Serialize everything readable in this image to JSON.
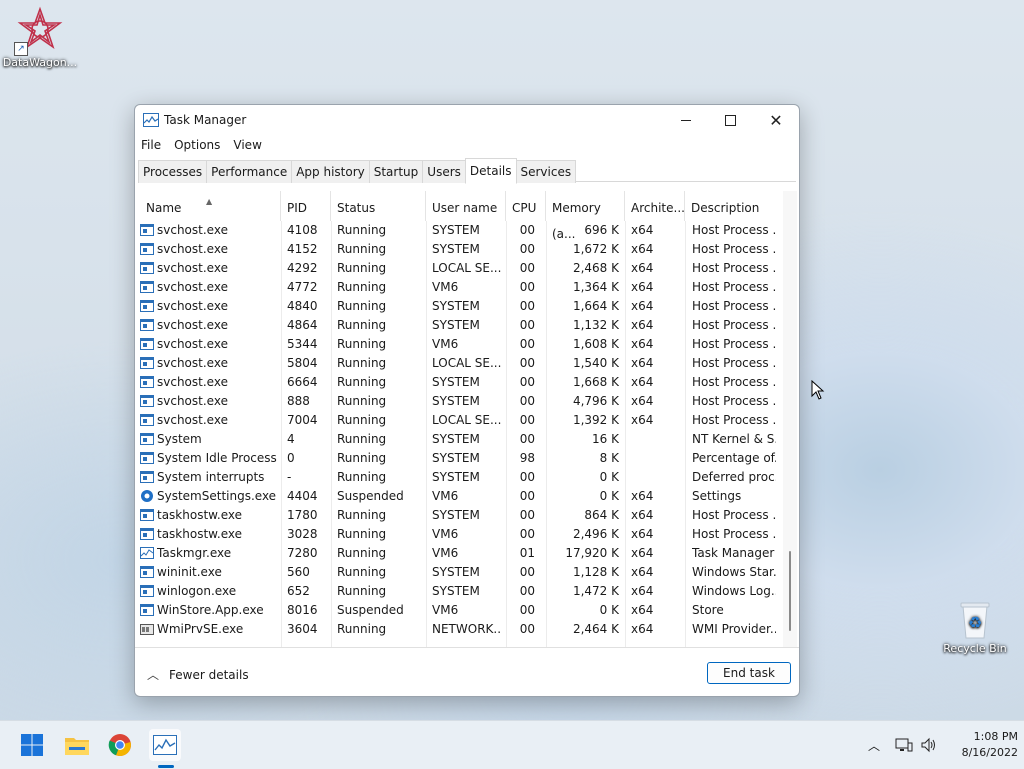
{
  "desktop": {
    "icons": [
      {
        "label": "DataWagon..."
      },
      {
        "label": "Recycle Bin"
      }
    ]
  },
  "window": {
    "title": "Task Manager",
    "menu": [
      "File",
      "Options",
      "View"
    ],
    "tabs": [
      "Processes",
      "Performance",
      "App history",
      "Startup",
      "Users",
      "Details",
      "Services"
    ],
    "active_tab": "Details",
    "columns": [
      "Name",
      "PID",
      "Status",
      "User name",
      "CPU",
      "Memory (a...",
      "Archite...",
      "Description"
    ],
    "rows": [
      {
        "name": "svchost.exe",
        "pid": "4108",
        "status": "Running",
        "user": "SYSTEM",
        "cpu": "00",
        "mem": "696 K",
        "arch": "x64",
        "desc": "Host Process ..."
      },
      {
        "name": "svchost.exe",
        "pid": "4152",
        "status": "Running",
        "user": "SYSTEM",
        "cpu": "00",
        "mem": "1,672 K",
        "arch": "x64",
        "desc": "Host Process ..."
      },
      {
        "name": "svchost.exe",
        "pid": "4292",
        "status": "Running",
        "user": "LOCAL SE...",
        "cpu": "00",
        "mem": "2,468 K",
        "arch": "x64",
        "desc": "Host Process ..."
      },
      {
        "name": "svchost.exe",
        "pid": "4772",
        "status": "Running",
        "user": "VM6",
        "cpu": "00",
        "mem": "1,364 K",
        "arch": "x64",
        "desc": "Host Process ..."
      },
      {
        "name": "svchost.exe",
        "pid": "4840",
        "status": "Running",
        "user": "SYSTEM",
        "cpu": "00",
        "mem": "1,664 K",
        "arch": "x64",
        "desc": "Host Process ..."
      },
      {
        "name": "svchost.exe",
        "pid": "4864",
        "status": "Running",
        "user": "SYSTEM",
        "cpu": "00",
        "mem": "1,132 K",
        "arch": "x64",
        "desc": "Host Process ..."
      },
      {
        "name": "svchost.exe",
        "pid": "5344",
        "status": "Running",
        "user": "VM6",
        "cpu": "00",
        "mem": "1,608 K",
        "arch": "x64",
        "desc": "Host Process ..."
      },
      {
        "name": "svchost.exe",
        "pid": "5804",
        "status": "Running",
        "user": "LOCAL SE...",
        "cpu": "00",
        "mem": "1,540 K",
        "arch": "x64",
        "desc": "Host Process ..."
      },
      {
        "name": "svchost.exe",
        "pid": "6664",
        "status": "Running",
        "user": "SYSTEM",
        "cpu": "00",
        "mem": "1,668 K",
        "arch": "x64",
        "desc": "Host Process ..."
      },
      {
        "name": "svchost.exe",
        "pid": "888",
        "status": "Running",
        "user": "SYSTEM",
        "cpu": "00",
        "mem": "4,796 K",
        "arch": "x64",
        "desc": "Host Process ..."
      },
      {
        "name": "svchost.exe",
        "pid": "7004",
        "status": "Running",
        "user": "LOCAL SE...",
        "cpu": "00",
        "mem": "1,392 K",
        "arch": "x64",
        "desc": "Host Process ..."
      },
      {
        "name": "System",
        "pid": "4",
        "status": "Running",
        "user": "SYSTEM",
        "cpu": "00",
        "mem": "16 K",
        "arch": "",
        "desc": "NT Kernel & S..."
      },
      {
        "name": "System Idle Process",
        "pid": "0",
        "status": "Running",
        "user": "SYSTEM",
        "cpu": "98",
        "mem": "8 K",
        "arch": "",
        "desc": "Percentage of..."
      },
      {
        "name": "System interrupts",
        "pid": "-",
        "status": "Running",
        "user": "SYSTEM",
        "cpu": "00",
        "mem": "0 K",
        "arch": "",
        "desc": "Deferred proc..."
      },
      {
        "name": "SystemSettings.exe",
        "pid": "4404",
        "status": "Suspended",
        "user": "VM6",
        "cpu": "00",
        "mem": "0 K",
        "arch": "x64",
        "desc": "Settings",
        "icon": "gear"
      },
      {
        "name": "taskhostw.exe",
        "pid": "1780",
        "status": "Running",
        "user": "SYSTEM",
        "cpu": "00",
        "mem": "864 K",
        "arch": "x64",
        "desc": "Host Process ..."
      },
      {
        "name": "taskhostw.exe",
        "pid": "3028",
        "status": "Running",
        "user": "VM6",
        "cpu": "00",
        "mem": "2,496 K",
        "arch": "x64",
        "desc": "Host Process ..."
      },
      {
        "name": "Taskmgr.exe",
        "pid": "7280",
        "status": "Running",
        "user": "VM6",
        "cpu": "01",
        "mem": "17,920 K",
        "arch": "x64",
        "desc": "Task Manager",
        "icon": "taskmgr"
      },
      {
        "name": "wininit.exe",
        "pid": "560",
        "status": "Running",
        "user": "SYSTEM",
        "cpu": "00",
        "mem": "1,128 K",
        "arch": "x64",
        "desc": "Windows Star..."
      },
      {
        "name": "winlogon.exe",
        "pid": "652",
        "status": "Running",
        "user": "SYSTEM",
        "cpu": "00",
        "mem": "1,472 K",
        "arch": "x64",
        "desc": "Windows Log..."
      },
      {
        "name": "WinStore.App.exe",
        "pid": "8016",
        "status": "Suspended",
        "user": "VM6",
        "cpu": "00",
        "mem": "0 K",
        "arch": "x64",
        "desc": "Store"
      },
      {
        "name": "WmiPrvSE.exe",
        "pid": "3604",
        "status": "Running",
        "user": "NETWORK...",
        "cpu": "00",
        "mem": "2,464 K",
        "arch": "x64",
        "desc": "WMI Provider...",
        "icon": "wmi"
      }
    ],
    "footer": {
      "fewer_details": "Fewer details",
      "end_task": "End task"
    }
  },
  "taskbar": {
    "time": "1:08 PM",
    "date": "8/16/2022"
  },
  "colors": {
    "accent": "#0067c0",
    "icon_blue": "#2a6fb8"
  }
}
